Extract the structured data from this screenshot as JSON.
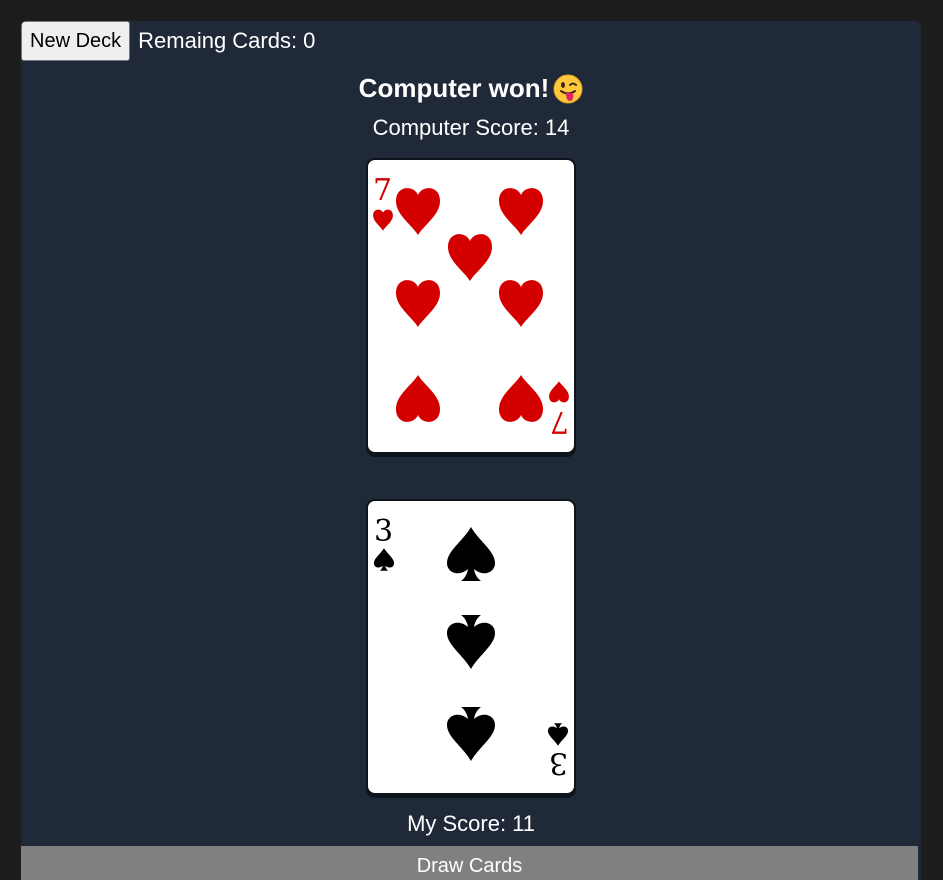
{
  "toolbar": {
    "new_deck_label": "New Deck",
    "remaining_label": "Remaing Cards:",
    "remaining_count": "0"
  },
  "result": {
    "message": "Computer won!",
    "emoji": "face-with-tongue-winking"
  },
  "computer": {
    "score_label": "Computer Score:",
    "score": "14",
    "card": {
      "rank": "7",
      "suit": "hearts",
      "color": "#d40000"
    }
  },
  "player": {
    "score_label": "My Score:",
    "score": "11",
    "card": {
      "rank": "3",
      "suit": "spades",
      "color": "#000000"
    }
  },
  "actions": {
    "draw_label": "Draw Cards"
  },
  "colors": {
    "background": "#1c1c1c",
    "panel": "#202938",
    "draw_button": "#808080"
  }
}
